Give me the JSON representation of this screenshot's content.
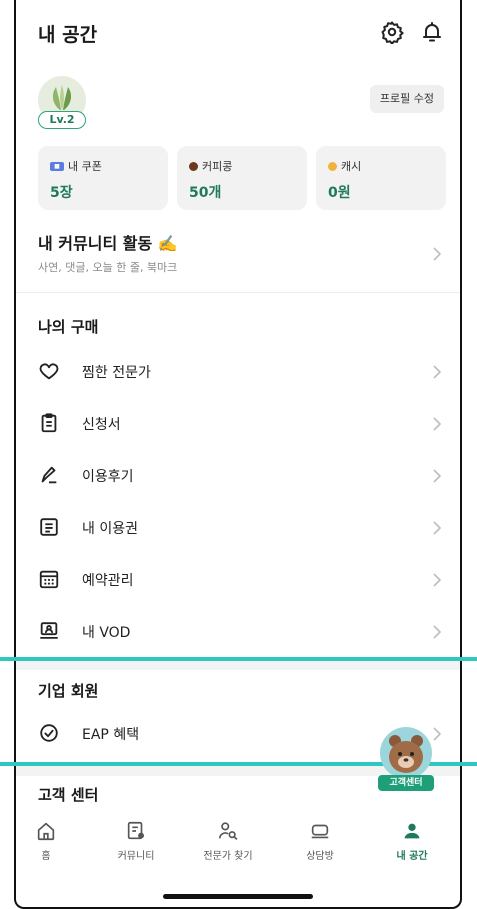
{
  "header": {
    "title": "내 공간"
  },
  "profile": {
    "level": "Lv.2",
    "edit_label": "프로필 수정"
  },
  "stats": [
    {
      "label": "내 쿠폰",
      "value": "5장",
      "icon": "coupon-icon"
    },
    {
      "label": "커피콩",
      "value": "50개",
      "icon": "coffee-bean-icon",
      "icon_color": "#6b3a1c"
    },
    {
      "label": "캐시",
      "value": "0원",
      "icon": "coin-icon",
      "icon_color": "#f2b33d"
    }
  ],
  "community": {
    "title": "내 커뮤니티 활동 ✍️",
    "subtitle": "사연, 댓글, 오늘 한 줄, 북마크"
  },
  "purchases": {
    "title": "나의 구매",
    "items": [
      {
        "label": "찜한 전문가",
        "icon": "heart-icon"
      },
      {
        "label": "신청서",
        "icon": "clipboard-icon"
      },
      {
        "label": "이용후기",
        "icon": "pen-icon"
      },
      {
        "label": "내 이용권",
        "icon": "list-card-icon"
      },
      {
        "label": "예약관리",
        "icon": "calendar-icon"
      },
      {
        "label": "내 VOD",
        "icon": "video-lecture-icon"
      }
    ]
  },
  "corporate": {
    "title": "기업 회원",
    "items": [
      {
        "label": "EAP 혜택",
        "icon": "check-circle-icon"
      }
    ]
  },
  "support": {
    "title": "고객 센터",
    "fab_label": "고객센터"
  },
  "tabs": [
    {
      "label": "홈",
      "icon": "home-icon",
      "active": false
    },
    {
      "label": "커뮤니티",
      "icon": "community-icon",
      "active": false
    },
    {
      "label": "전문가 찾기",
      "icon": "find-expert-icon",
      "active": false
    },
    {
      "label": "상담방",
      "icon": "chat-room-icon",
      "active": false
    },
    {
      "label": "내 공간",
      "icon": "my-space-icon",
      "active": true
    }
  ],
  "colors": {
    "accent": "#1f7a58",
    "highlight_line": "#2ec8c0"
  }
}
